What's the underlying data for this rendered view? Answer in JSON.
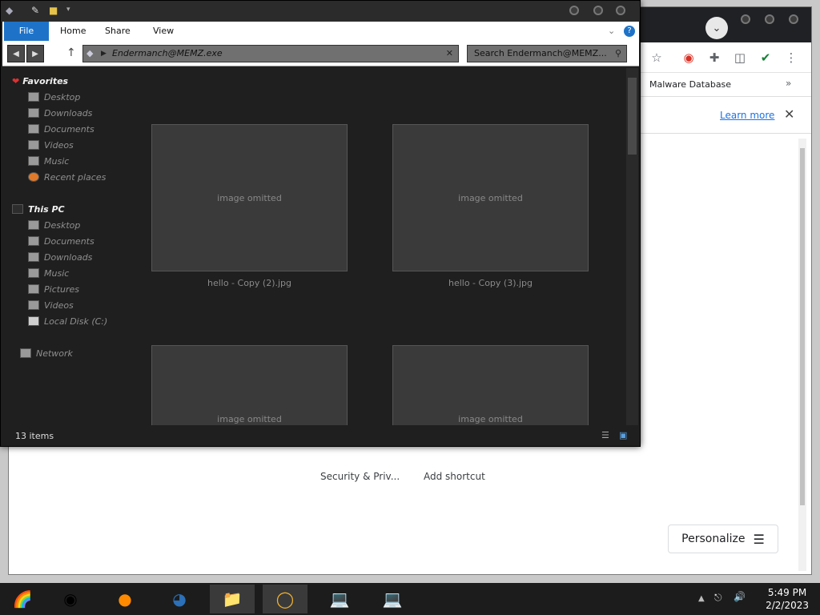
{
  "browser": {
    "bookmark_item": "Malware Database",
    "infobar_link": "Learn more",
    "shortcuts": [
      "Security & Priv...",
      "Add shortcut"
    ],
    "personalize_label": "Personalize",
    "icons": [
      "chevron-down-icon",
      "star-icon",
      "extension-icon",
      "sidebar-icon",
      "shield-icon",
      "more-icon",
      "close-icon",
      "sliders-icon"
    ]
  },
  "explorer": {
    "ribbon_tabs": [
      "File",
      "Home",
      "Share",
      "View"
    ],
    "address_path": "Endermanch@MEMZ.exe",
    "search_placeholder": "Search Endermanch@MEMZ...",
    "favorites": {
      "header": "Favorites",
      "items": [
        "Desktop",
        "Downloads",
        "Documents",
        "Videos",
        "Music",
        "Recent places"
      ]
    },
    "this_pc": {
      "header": "This PC",
      "items": [
        "Desktop",
        "Documents",
        "Downloads",
        "Music",
        "Pictures",
        "Videos",
        "Local Disk (C:)"
      ]
    },
    "network_label": "Network",
    "files": [
      "hello - Copy (2).jpg",
      "hello - Copy (3).jpg"
    ],
    "status_items": "13 items"
  },
  "taskbar": {
    "time": "5:49 PM",
    "date": "2/2/2023"
  },
  "colors": {
    "ribbon_file_tab": "#1e73c8",
    "explorer_bg": "#1f1f1f",
    "taskbar_bg": "#1c1c1c"
  }
}
